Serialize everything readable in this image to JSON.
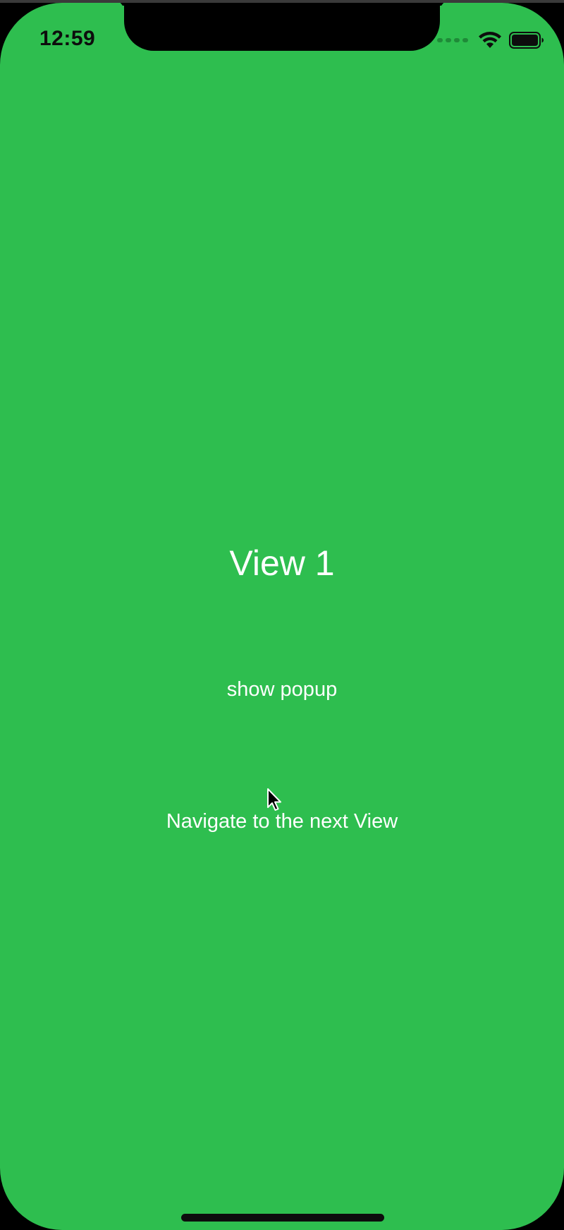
{
  "status_bar": {
    "time": "12:59",
    "icons": [
      "signal-dots-icon",
      "wifi-icon",
      "battery-icon"
    ]
  },
  "main": {
    "title": "View 1",
    "show_popup_label": "show popup",
    "navigate_label": "Navigate to the next View"
  },
  "colors": {
    "background": "#2ebe4f",
    "text": "#ffffff",
    "status_text": "#0d0d0d"
  }
}
